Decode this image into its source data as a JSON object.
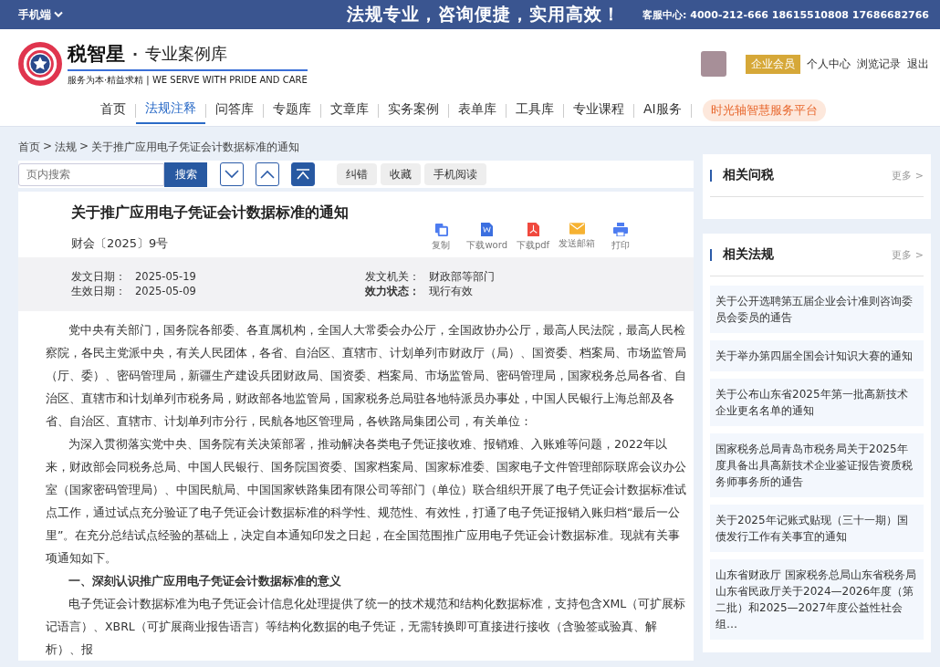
{
  "top_bar": {
    "mobile_label": "手机端",
    "slogan": "法规专业，咨询便捷，实用高效！",
    "service_label": "客服中心:",
    "phones": "4000-212-666 18615510808 17686682766"
  },
  "header": {
    "logo": {
      "name": "税智星",
      "separator": "·",
      "subtitle": "专业案例库",
      "tagline": "服务为本·精益求精 | WE SERVE WITH PRIDE AND CARE"
    },
    "member_badge": "企业会员",
    "user_links": [
      "个人中心",
      "浏览记录",
      "退出"
    ]
  },
  "nav": {
    "items": [
      {
        "label": "首页",
        "selected": false
      },
      {
        "label": "法规注释",
        "selected": true
      },
      {
        "label": "问答库",
        "selected": false
      },
      {
        "label": "专题库",
        "selected": false
      },
      {
        "label": "文章库",
        "selected": false
      },
      {
        "label": "实务案例",
        "selected": false
      },
      {
        "label": "表单库",
        "selected": false
      },
      {
        "label": "工具库",
        "selected": false
      },
      {
        "label": "专业课程",
        "selected": false
      },
      {
        "label": "AI服务",
        "selected": false
      }
    ],
    "highlight": "时光轴智慧服务平台"
  },
  "breadcrumb": {
    "separator": ">",
    "items": [
      "首页",
      "法规",
      "关于推广应用电子凭证会计数据标准的通知"
    ]
  },
  "toolbar": {
    "search": {
      "placeholder": "页内搜索",
      "button": "搜索"
    },
    "buttons": [
      "纠错",
      "收藏",
      "手机阅读"
    ]
  },
  "article": {
    "title": "关于推广应用电子凭证会计数据标准的通知",
    "doc_number": "财会〔2025〕9号",
    "actions": [
      {
        "kind": "copy",
        "label": "复制"
      },
      {
        "kind": "word",
        "label": "下载word"
      },
      {
        "kind": "pdf",
        "label": "下载pdf"
      },
      {
        "kind": "mail",
        "label": "发送邮箱"
      },
      {
        "kind": "print",
        "label": "打印"
      }
    ],
    "meta": [
      {
        "label": "发文日期：",
        "value": "2025-05-19",
        "emphasis": false
      },
      {
        "label": "发文机关：",
        "value": "财政部等部门",
        "emphasis": false
      },
      {
        "label": "生效日期：",
        "value": "2025-05-09",
        "emphasis": false
      },
      {
        "label": "效力状态：",
        "value": "现行有效",
        "emphasis": true
      }
    ],
    "paragraphs": [
      {
        "kind": "text",
        "text": "党中央有关部门，国务院各部委、各直属机构，全国人大常委会办公厅，全国政协办公厅，最高人民法院，最高人民检察院，各民主党派中央，有关人民团体，各省、自治区、直辖市、计划单列市财政厅（局）、国资委、档案局、市场监管局（厅、委）、密码管理局，新疆生产建设兵团财政局、国资委、档案局、市场监管局、密码管理局，国家税务总局各省、自治区、直辖市和计划单列市税务局，财政部各地监管局，国家税务总局驻各地特派员办事处，中国人民银行上海总部及各省、自治区、直辖市、计划单列市分行，民航各地区管理局，各铁路局集团公司，有关单位："
      },
      {
        "kind": "text",
        "text": "为深入贯彻落实党中央、国务院有关决策部署，推动解决各类电子凭证接收难、报销难、入账难等问题，2022年以来，财政部会同税务总局、中国人民银行、国务院国资委、国家档案局、国家标准委、国家电子文件管理部际联席会议办公室（国家密码管理局）、中国民航局、中国国家铁路集团有限公司等部门（单位）联合组织开展了电子凭证会计数据标准试点工作，通过试点充分验证了电子凭证会计数据标准的科学性、规范性、有效性，打通了电子凭证报销入账归档“最后一公里”。在充分总结试点经验的基础上，决定自本通知印发之日起，在全国范围推广应用电子凭证会计数据标准。现就有关事项通知如下。"
      },
      {
        "kind": "heading",
        "text": "一、深刻认识推广应用电子凭证会计数据标准的意义"
      },
      {
        "kind": "text",
        "text": "电子凭证会计数据标准为电子凭证会计信息化处理提供了统一的技术规范和结构化数据标准，支持包含XML（可扩展标记语言）、XBRL（可扩展商业报告语言）等结构化数据的电子凭证，无需转换即可直接进行接收（含验签或验真、解析）、报"
      }
    ]
  },
  "sidebar": [
    {
      "title": "相关问税",
      "more": "更多 >"
    },
    {
      "title": "相关法规",
      "more": "更多 >",
      "items": [
        "关于公开选聘第五届企业会计准则咨询委员会委员的通告",
        "关于举办第四届全国会计知识大赛的通知",
        "关于公布山东省2025年第一批高新技术企业更名名单的通知",
        "国家税务总局青岛市税务局关于2025年度具备出具高新技术企业鉴证报告资质税务师事务所的通告",
        "关于2025年记账式贴现（三十一期）国债发行工作有关事宜的通知",
        "山东省财政厅 国家税务总局山东省税务局山东省民政厅关于2024—2026年度（第二批）和2025—2027年度公益性社会组…"
      ]
    }
  ]
}
